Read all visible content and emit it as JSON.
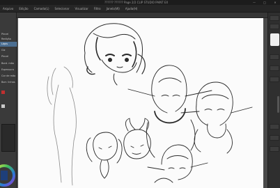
{
  "window": {
    "title": "?????? ?????? Page 2/2 CLIP STUDIO PAINT EX",
    "controls": [
      "—",
      "□",
      "✕"
    ]
  },
  "menu": {
    "items": [
      "Arquivo",
      "Edição",
      "Camada(L)",
      "Selecionar",
      "Visualizar",
      "Filtro",
      "Janela(W)",
      "Ajuda(H)"
    ]
  },
  "left_panel": {
    "rows": [
      {
        "label": "Pincel",
        "selected": false
      },
      {
        "label": "Redição",
        "selected": false
      },
      {
        "label": "Lápis",
        "selected": true
      },
      {
        "label": "Giz",
        "selected": false
      },
      {
        "label": "Pincel",
        "selected": false
      },
      {
        "label": "Bord. mão",
        "selected": false
      },
      {
        "label": "Espessura",
        "selected": false
      },
      {
        "label": "Cor de mão",
        "selected": false
      },
      {
        "label": "Borr. linhas",
        "selected": false
      }
    ],
    "accent_color": "#4c6f92"
  },
  "icons": {
    "color_wheel": "color-wheel-icon",
    "minimize": "minimize-icon",
    "maximize": "maximize-icon",
    "close": "close-icon"
  }
}
